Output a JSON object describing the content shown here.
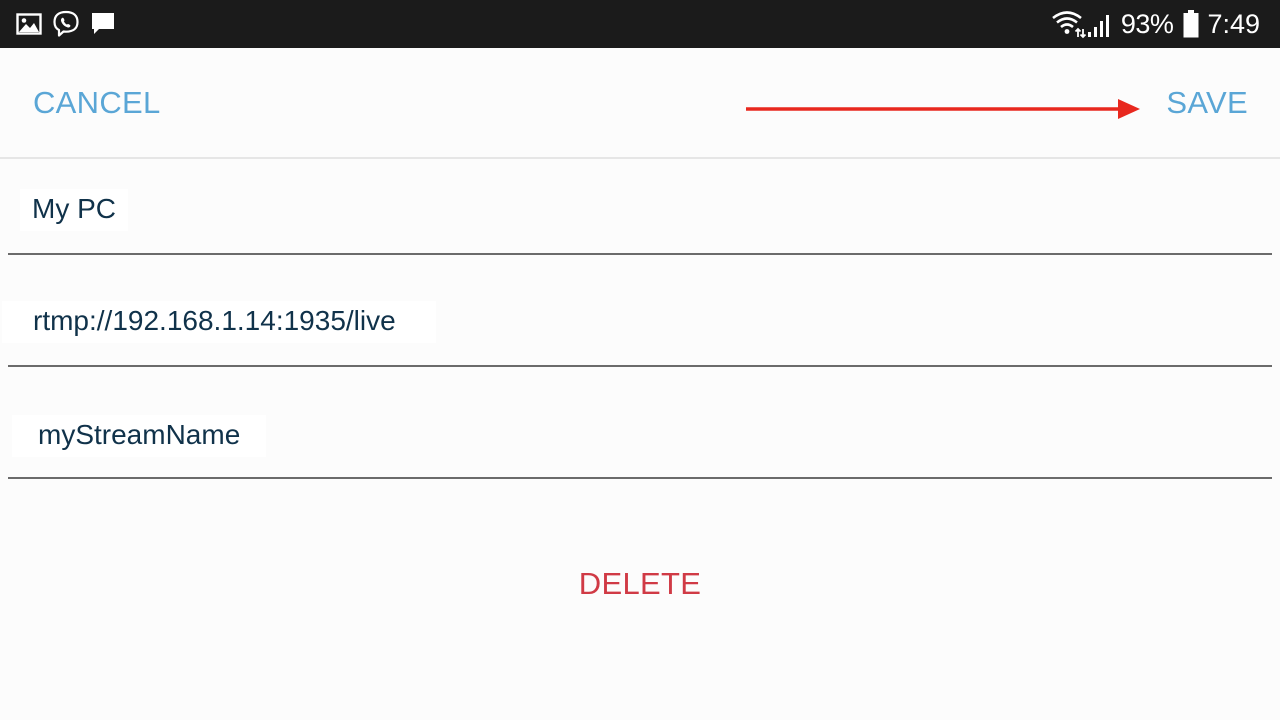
{
  "status_bar": {
    "left_icons": [
      "image-icon",
      "viber-icon",
      "message-icon"
    ],
    "right_icons": [
      "wifi-icon",
      "cellular-signal-icon",
      "battery-icon"
    ],
    "battery_percent": "93%",
    "time": "7:49"
  },
  "action_bar": {
    "cancel_label": "CANCEL",
    "save_label": "SAVE",
    "accent_color": "#5aa6d6"
  },
  "annotation": {
    "arrow_color": "#e8281e",
    "arrow_target": "save-button"
  },
  "form": {
    "name_value": "My PC",
    "url_value": "rtmp://192.168.1.14:1935/live",
    "stream_value": "myStreamName"
  },
  "delete_label": "DELETE",
  "delete_color": "#d03a45"
}
